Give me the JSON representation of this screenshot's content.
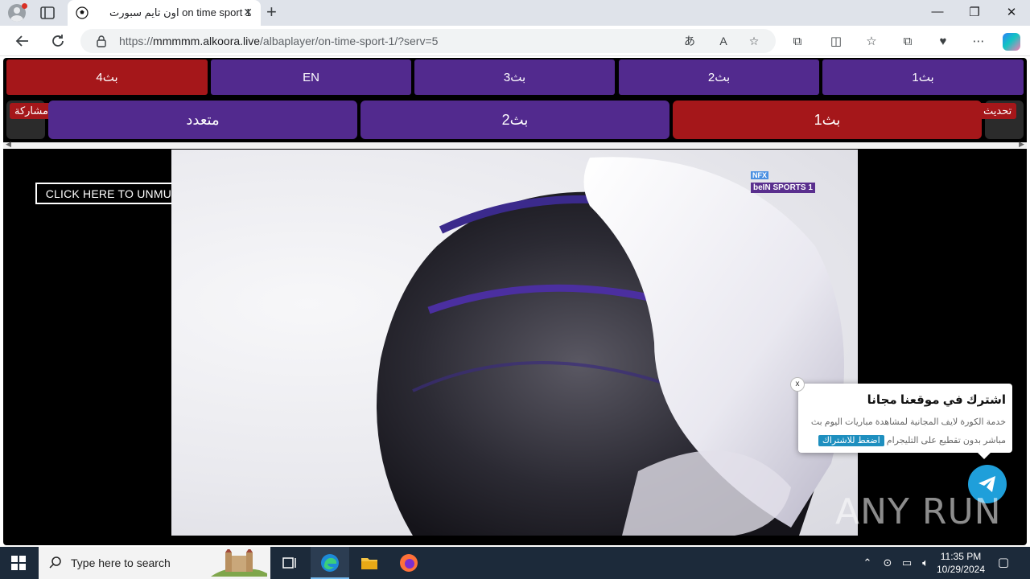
{
  "browser": {
    "tab": {
      "title": "اون تايم سبورت on time sport 1"
    },
    "url": {
      "prefix": "https://",
      "host": "mmmmm.alkoora.live",
      "path": "/albaplayer/on-time-sport-1/?serv=5"
    }
  },
  "player": {
    "servers": [
      {
        "label": "بث4",
        "active": true
      },
      {
        "label": "EN",
        "active": false
      },
      {
        "label": "بث3",
        "active": false
      },
      {
        "label": "بث2",
        "active": false
      },
      {
        "label": "بث1",
        "active": false
      }
    ],
    "channels": [
      {
        "label": "متعدد",
        "active": false
      },
      {
        "label": "بث2",
        "active": false
      },
      {
        "label": "بث1",
        "active": true
      }
    ],
    "share_label": "مشاركة",
    "refresh_label": "تحديث",
    "unmute_label": "CLICK HERE TO UNMUTE",
    "channel_logo": {
      "tag": "NFX",
      "name": "beIN SPORTS 1"
    }
  },
  "popup": {
    "close": "x",
    "title": "اشترك في موقعنا مجانا",
    "body_line1": "خدمة الكورة لايف المجانية لمشاهدة مباريات اليوم بث",
    "body_line2": "مباشر بدون تقطيع على التليجرام",
    "cta": "اضغط للاشتراك"
  },
  "watermark": "ANY RUN",
  "taskbar": {
    "search_placeholder": "Type here to search",
    "time": "11:35 PM",
    "date": "10/29/2024"
  }
}
